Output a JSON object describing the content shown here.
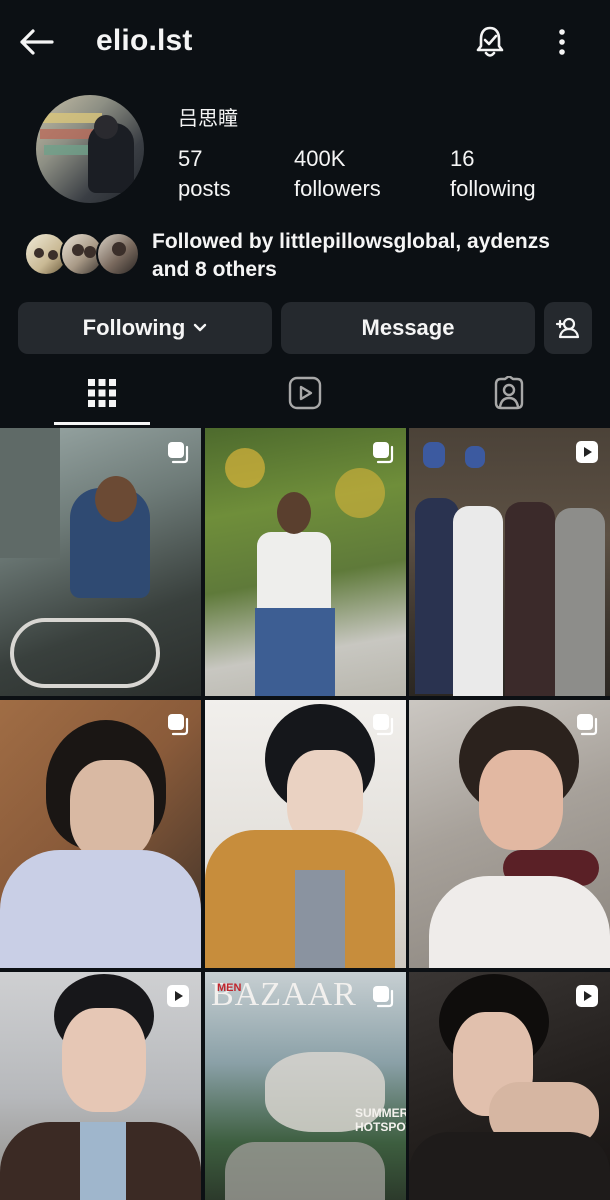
{
  "header": {
    "username": "elio.lst",
    "icons": [
      "back-arrow-icon",
      "bell-icon",
      "more-vertical-icon"
    ]
  },
  "profile": {
    "display_name": "吕思瞳",
    "stats": {
      "posts": {
        "value": "57",
        "label": "posts"
      },
      "followers": {
        "value": "400K",
        "label": "followers"
      },
      "following": {
        "value": "16",
        "label": "following"
      }
    },
    "followed_by": "Followed by littlepillowsglobal, aydenzs and 8 others"
  },
  "actions": {
    "following_label": "Following",
    "message_label": "Message"
  },
  "tabs": {
    "active": "grid",
    "items": [
      "posts-grid-icon",
      "reels-icon",
      "tagged-icon"
    ]
  },
  "grid": {
    "posts": [
      {
        "type": "carousel"
      },
      {
        "type": "carousel"
      },
      {
        "type": "reel"
      },
      {
        "type": "carousel"
      },
      {
        "type": "carousel"
      },
      {
        "type": "carousel"
      },
      {
        "type": "reel"
      },
      {
        "type": "carousel",
        "magazine": "BAZAAR",
        "magazine_sub": "MEN",
        "cover_line": "SUMMERY HOTSPOT"
      },
      {
        "type": "reel"
      }
    ]
  },
  "colors": {
    "background": "#0c1014",
    "button": "#25292e",
    "text": "#f5f5f5"
  }
}
